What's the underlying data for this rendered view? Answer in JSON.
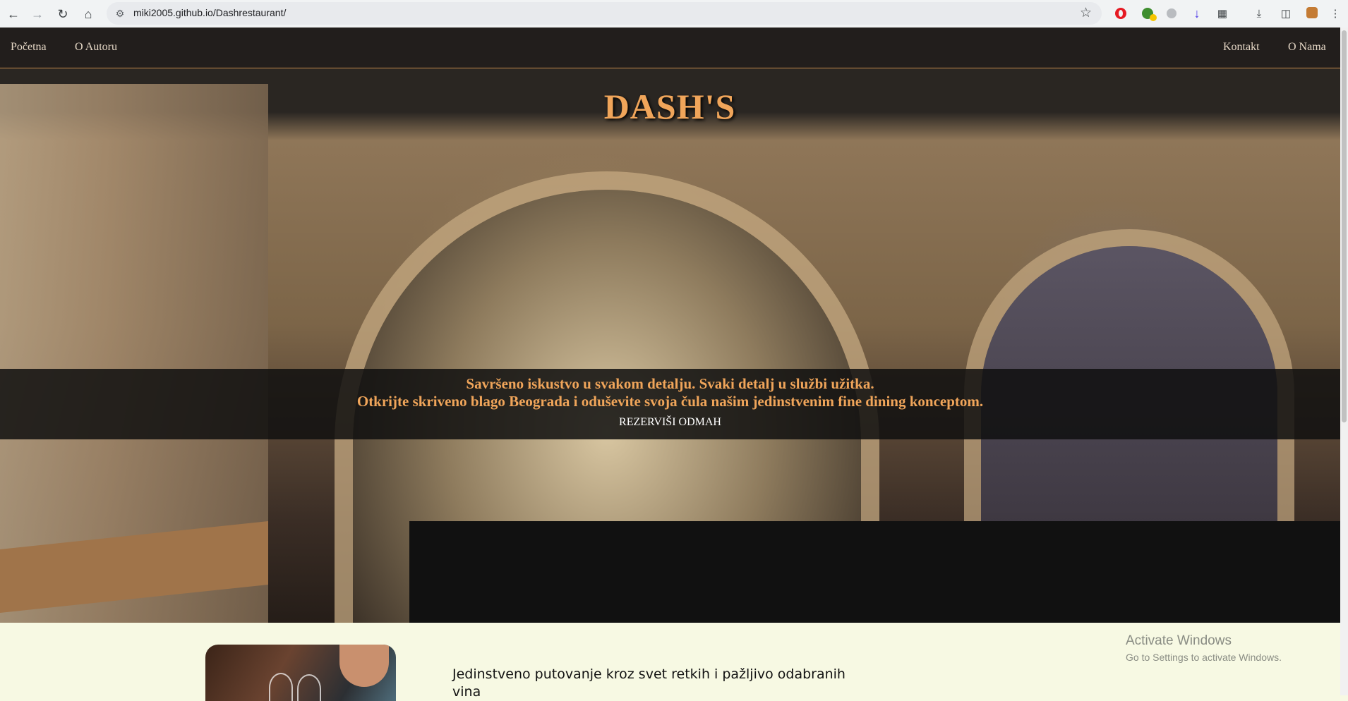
{
  "browser": {
    "url": "miki2005.github.io/Dashrestaurant/"
  },
  "nav": {
    "left": [
      "Početna",
      "O Autoru"
    ],
    "right": [
      "Kontakt",
      "O Nama"
    ]
  },
  "hero": {
    "brand": "DASH'S",
    "tagline_1": "Savršeno iskustvo u svakom detalju. Svaki detalj u službi užitka.",
    "tagline_2": "Otkrijte skriveno blago Beograda i oduševite svoja čula našim jedinstvenim fine dining konceptom.",
    "cta": "REZERVIŠI ODMAH"
  },
  "section": {
    "intro": "Jedinstveno putovanje kroz svet retkih i pažljivo odabranih vina"
  },
  "watermark": {
    "title": "Activate Windows",
    "subtitle": "Go to Settings to activate Windows."
  },
  "colors": {
    "accent": "#f0a55a",
    "background": "#f7f9e3",
    "nav_text": "#e6d8c6"
  }
}
